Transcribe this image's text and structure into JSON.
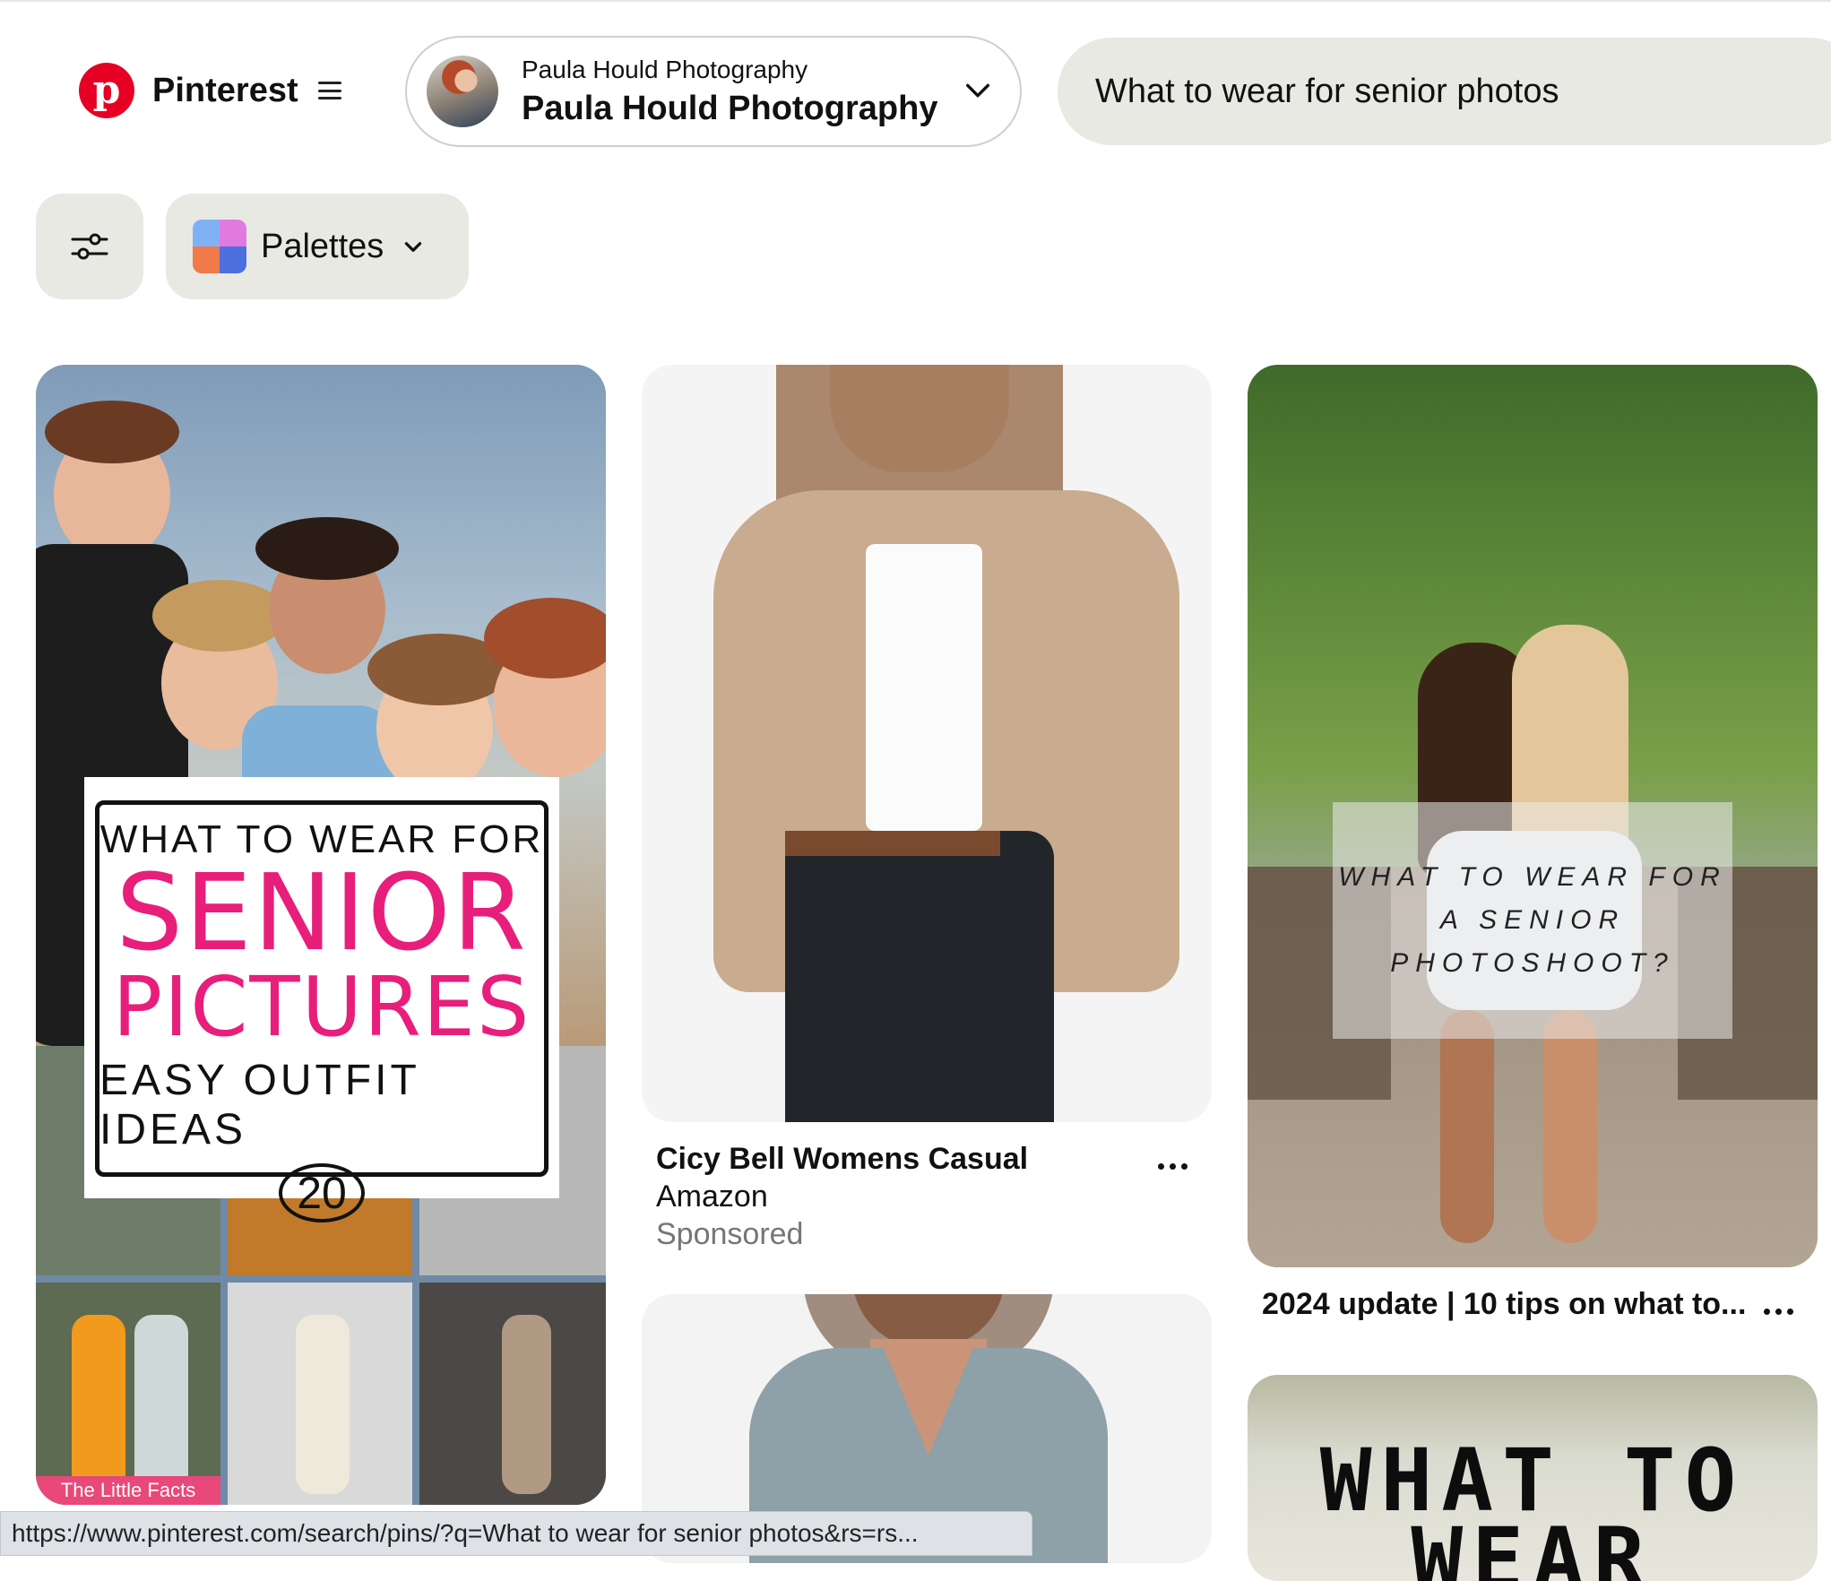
{
  "header": {
    "brand_name": "Pinterest",
    "account_small": "Paula Hould Photography",
    "account_big": "Paula Hould Photography",
    "search_value": "What to wear for senior photos"
  },
  "filters": {
    "palettes_label": "Palettes"
  },
  "pins": {
    "pin1": {
      "line1": "WHAT TO WEAR FOR",
      "line2": "SENIOR",
      "line3": "PICTURES",
      "line4": "EASY OUTFIT IDEAS",
      "number": "20",
      "footer": "The Little Facts"
    },
    "pin2": {
      "title": "Cicy Bell Womens Casual",
      "merchant": "Amazon",
      "sponsored": "Sponsored"
    },
    "pin3": {
      "overlay_line1": "WHAT TO WEAR FOR",
      "overlay_line2": "A SENIOR",
      "overlay_line3": "PHOTOSHOOT?",
      "title": "2024 update | 10 tips on what to..."
    },
    "pin5": {
      "line1": "WHAT TO",
      "line2": "WEAR"
    }
  },
  "status_bar": {
    "url": "https://www.pinterest.com/search/pins/?q=What to wear for senior photos&rs=rs..."
  },
  "colors": {
    "brand": "#e60023",
    "pill_bg": "#e9e9e4",
    "accent_pink": "#e81e7b"
  },
  "icons": [
    "pinterest-logo-icon",
    "menu-icon",
    "chevron-down-icon",
    "filter-sliders-icon",
    "palette-icon",
    "more-icon"
  ]
}
